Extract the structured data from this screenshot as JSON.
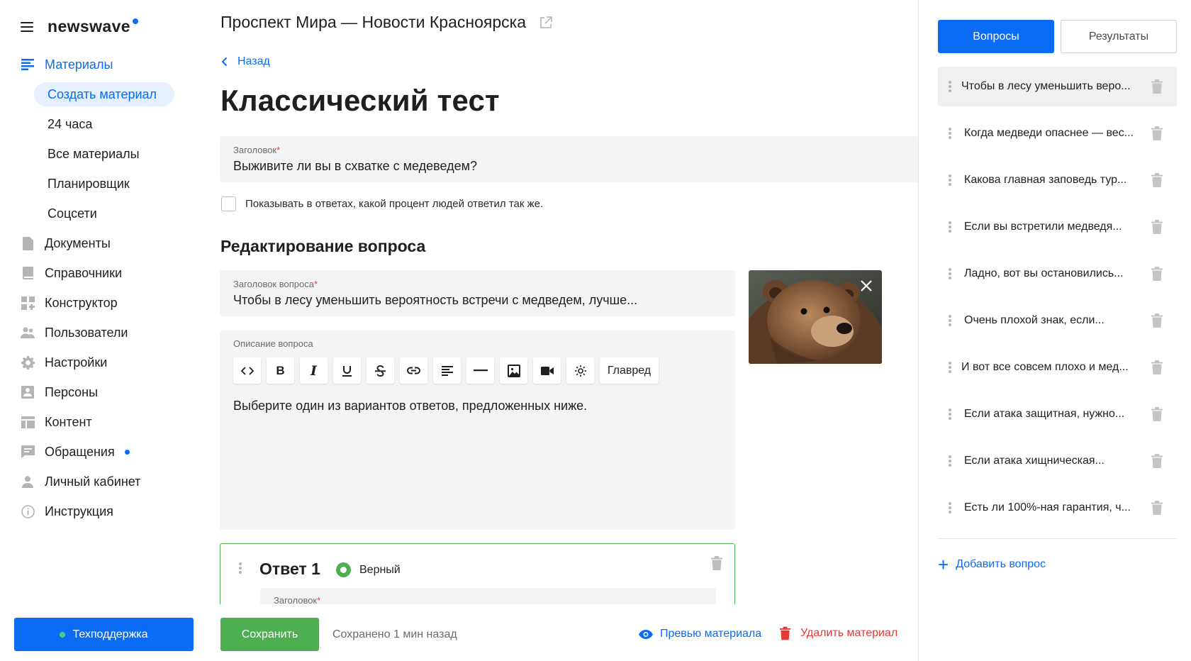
{
  "brand": {
    "name": "newswave"
  },
  "nav": {
    "materials": "Материалы",
    "sub": [
      "Создать материал",
      "24 часа",
      "Все материалы",
      "Планировщик",
      "Соцсети"
    ],
    "items": [
      "Документы",
      "Справочники",
      "Конструктор",
      "Пользователи",
      "Настройки",
      "Персоны",
      "Контент",
      "Обращения",
      "Личный кабинет",
      "Инструкция"
    ]
  },
  "support": {
    "label": "Техподдержка"
  },
  "header": {
    "site_title": "Проспект Мира — Новости Красноярска",
    "back_label": "Назад"
  },
  "page": {
    "title": "Классический тест"
  },
  "title_field": {
    "label": "Заголовок",
    "value": "Выживите ли вы в схватке с медеведем?"
  },
  "show_percent": {
    "label": "Показывать в ответах, какой процент людей ответил так же.",
    "checked": false
  },
  "question_edit": {
    "section_title": "Редактирование вопроса",
    "title_label": "Заголовок вопроса",
    "title_value": "Чтобы в лесу уменьшить вероятность встречи с медведем, лучше...",
    "desc_label": "Описание вопроса",
    "toolbar": {
      "editor_label": "Главред"
    },
    "desc_text": "Выберите один из вариантов ответов, предложенных ниже."
  },
  "answer": {
    "title": "Ответ 1",
    "correct_label": "Верный",
    "field_label": "Заголовок"
  },
  "bottom": {
    "save_label": "Сохранить",
    "saved_status": "Сохранено 1 мин назад",
    "preview_label": "Превью материала",
    "delete_label": "Удалить материал"
  },
  "right_panel": {
    "tab_questions": "Вопросы",
    "tab_results": "Результаты",
    "questions": [
      "Чтобы в лесу уменьшить веро...",
      "Когда медведи опаснее — вес...",
      "Какова главная заповедь тур...",
      "Если вы встретили медведя...",
      "Ладно, вот вы остановились...",
      "Очень плохой знак, если...",
      "И вот все совсем плохо и мед...",
      "Если атака защитная, нужно...",
      "Если атака хищническая...",
      "Есть ли 100%-ная гарантия, ч..."
    ],
    "add_label": "Добавить вопрос"
  },
  "colors": {
    "accent": "#0a6cf5",
    "success": "#4caf50",
    "danger": "#e53935"
  }
}
